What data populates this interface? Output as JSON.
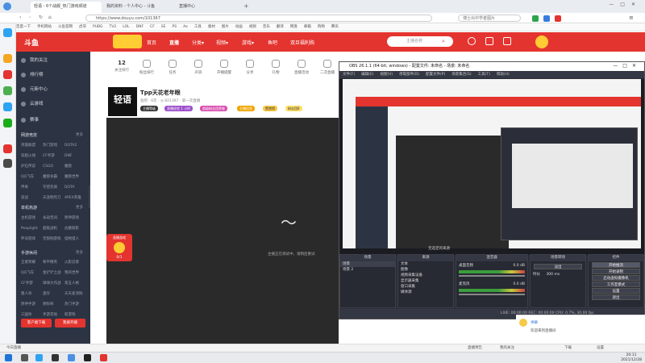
{
  "browser": {
    "tabs": [
      {
        "label": "轻语 - 6个战舰_热门游戏频道"
      },
      {
        "label": "我的资料 - 个人中心 - 斗鱼"
      },
      {
        "label": "直播中心"
      }
    ],
    "url": "https://www.douyu.com/101367",
    "search_placeholder": "博士出中学者图片"
  },
  "bookmarks": [
    "百度一下",
    "手机网站",
    "斗鱼官网",
    "虎牙",
    "PUBG",
    "TV2",
    "LOL",
    "DNF",
    "CF",
    "SE",
    "PS",
    "Ae",
    "工具",
    "素材",
    "图片",
    "动画",
    "视频",
    "音乐",
    "翻译",
    "网盘",
    "邮箱",
    "购物",
    "腾讯"
  ],
  "douyu": {
    "logo": "斗鱼",
    "nav": [
      "首页",
      "直播",
      "分类▾",
      "视频▾",
      "游戏▾",
      "鱼吧",
      "双旦福利购"
    ],
    "search_placeholder": "主播名称",
    "user_icons": [
      "历史",
      "关注",
      "下载",
      "开播",
      "消息"
    ]
  },
  "sidebar": {
    "items": [
      "我的关注",
      "排行榜",
      "元新中心",
      "云游戏",
      "赛事"
    ],
    "groups": [
      {
        "title": "网游竞技",
        "more": "更多",
        "items": [
          "英雄联盟",
          "热门游戏",
          "DOTA2",
          "穿越火线",
          "CF手游",
          "DNF",
          "炉石传说",
          "CSGO",
          "魔兽",
          "QQ飞车",
          "魔兽争霸",
          "魔兽世界",
          "传奇",
          "守望先锋",
          "DOTA",
          "逆战",
          "天涯明月刀",
          "APEX英雄"
        ]
      },
      {
        "title": "单机热游",
        "more": "更多",
        "items": [
          "主机游戏",
          "永劫无间",
          "原神游戏",
          "Peoplight",
          "超级战机",
          "古墓丽影",
          "怀旧游戏",
          "无限制游戏",
          "怪物猎人"
        ]
      },
      {
        "title": "手游休闲",
        "more": "更多",
        "items": [
          "王者荣耀",
          "和平精英",
          "火影忍者",
          "QQ飞车",
          "金铲铲之战",
          "我的世界",
          "CF手游",
          "球球大作战",
          "第五人格",
          "狼人杀",
          "蛋仔",
          "天天爱消除",
          "原神手游",
          "阴阳师",
          "热门手游",
          "三国杀",
          "手游其他",
          "新游戏"
        ]
      }
    ],
    "buttons": [
      "客户端下载",
      "我要开播"
    ]
  },
  "streamer": {
    "follow_count": "12",
    "follow_label": "关注排行",
    "top_icons": [
      "粉丝排行",
      "任务",
      "声浪",
      "开播提醒",
      "分享",
      "礼物",
      "直播活动",
      "二次直播"
    ],
    "room_name": "Tpp天花老年眼",
    "logo_text": "轻语",
    "meta": "鱼吧 · 6年 · ◎ 821397 · 第一次直播",
    "tags": [
      "主播等级",
      "直播经验 1 小时",
      "超级粉丝团荣誉",
      "主播信息",
      "赞赏榜",
      "粉丝团8"
    ],
    "corner_badge": "直播游戏",
    "corner_count": "0/1",
    "video_caption": "主播正在调试中，请稍后重试"
  },
  "obs": {
    "title": "OBS 26.1.1 (64-bit, windows) - 配置文件: 未命名 - 场景: 未命名",
    "menu": [
      "文件(F)",
      "编辑(E)",
      "视图(V)",
      "停靠部件(D)",
      "配置文件(P)",
      "场景集合(S)",
      "工具(T)",
      "帮助(H)"
    ],
    "panels": {
      "scenes": {
        "title": "场景",
        "items": [
          "场景",
          "场景 2"
        ]
      },
      "sources": {
        "title": "来源",
        "items": [
          "文本",
          "图像",
          "视频采集设备",
          "显示器采集",
          "窗口采集",
          "媒体源"
        ]
      },
      "mixer": {
        "title": "混音器",
        "channels": [
          {
            "name": "桌面音频",
            "level": "0.0 dB"
          },
          {
            "name": "麦克风",
            "level": "0.0 dB"
          }
        ]
      },
      "transitions": {
        "title": "场景转场",
        "type": "淡出",
        "duration_label": "时长",
        "duration": "300 ms"
      },
      "controls": {
        "title": "控件",
        "buttons": [
          "开始推流",
          "开始录制",
          "启动虚拟摄像机",
          "工作室模式",
          "设置",
          "退出"
        ]
      }
    },
    "no_source": "无选定的来源",
    "status": "LIVE: 00:00:00  REC: 00:00:00  CPU: 0.7%, 30.00 fps"
  },
  "chat": {
    "user": "弹幕",
    "text": "欢迎来到直播间"
  },
  "bottombar": {
    "left": "今日直播",
    "right_items": [
      "直播预告",
      "我的关注",
      "下载",
      "设置"
    ]
  },
  "taskbar": {
    "time": "20:11",
    "date": "2021/12/28"
  },
  "colors": {
    "brand": "#e4342f",
    "sidebar": "#2c3444",
    "obs_bg": "#2b2e38"
  }
}
